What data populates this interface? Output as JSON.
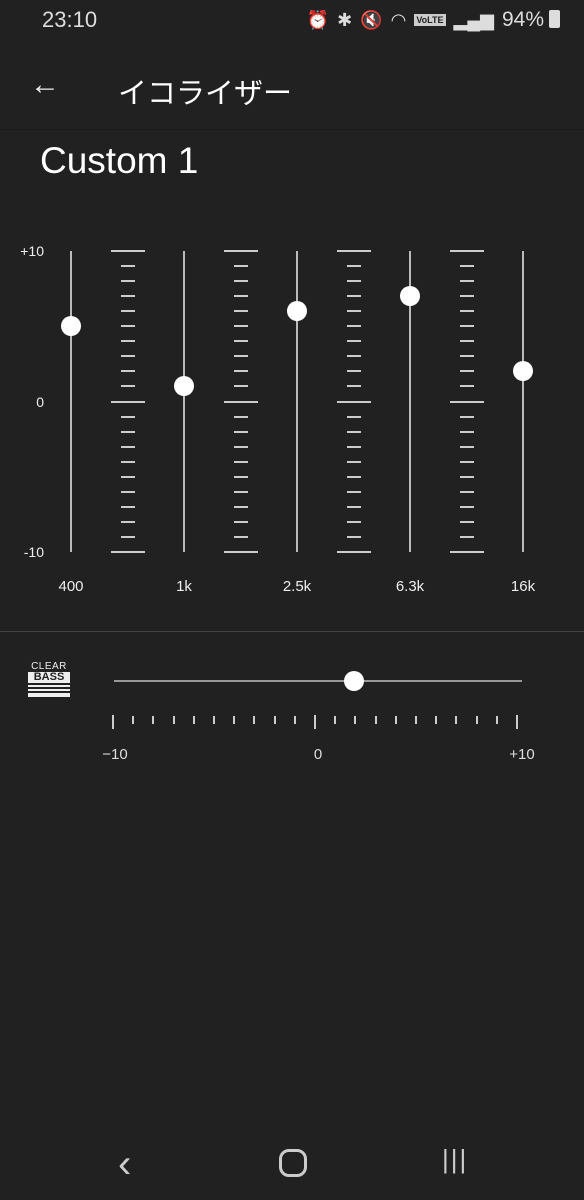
{
  "status_bar": {
    "time": "23:10",
    "battery": "94%",
    "icons": [
      "alarm-icon",
      "bluetooth-icon",
      "mute-vibrate-icon",
      "wifi-icon",
      "volte-icon",
      "signal-icon",
      "battery-icon"
    ],
    "volte": "VoLTE"
  },
  "app_bar": {
    "back_icon": "arrow-left-icon",
    "title": "イコライザー"
  },
  "preset_name": "Custom 1",
  "equalizer": {
    "y_labels": {
      "max": "+10",
      "mid": "0",
      "min": "-10"
    },
    "range": [
      -10,
      10
    ],
    "bands": [
      {
        "label": "400",
        "value": 5
      },
      {
        "label": "1k",
        "value": 1
      },
      {
        "label": "2.5k",
        "value": 6
      },
      {
        "label": "6.3k",
        "value": 7
      },
      {
        "label": "16k",
        "value": 2
      }
    ]
  },
  "clear_bass": {
    "logo_top": "CLEAR",
    "logo_bottom": "BASS",
    "value": 2,
    "range": [
      -10,
      10
    ],
    "labels": {
      "min": "−10",
      "mid": "0",
      "max": "+10"
    }
  },
  "nav_bar": {
    "back": "‹",
    "home": "○",
    "recents": "|||"
  }
}
